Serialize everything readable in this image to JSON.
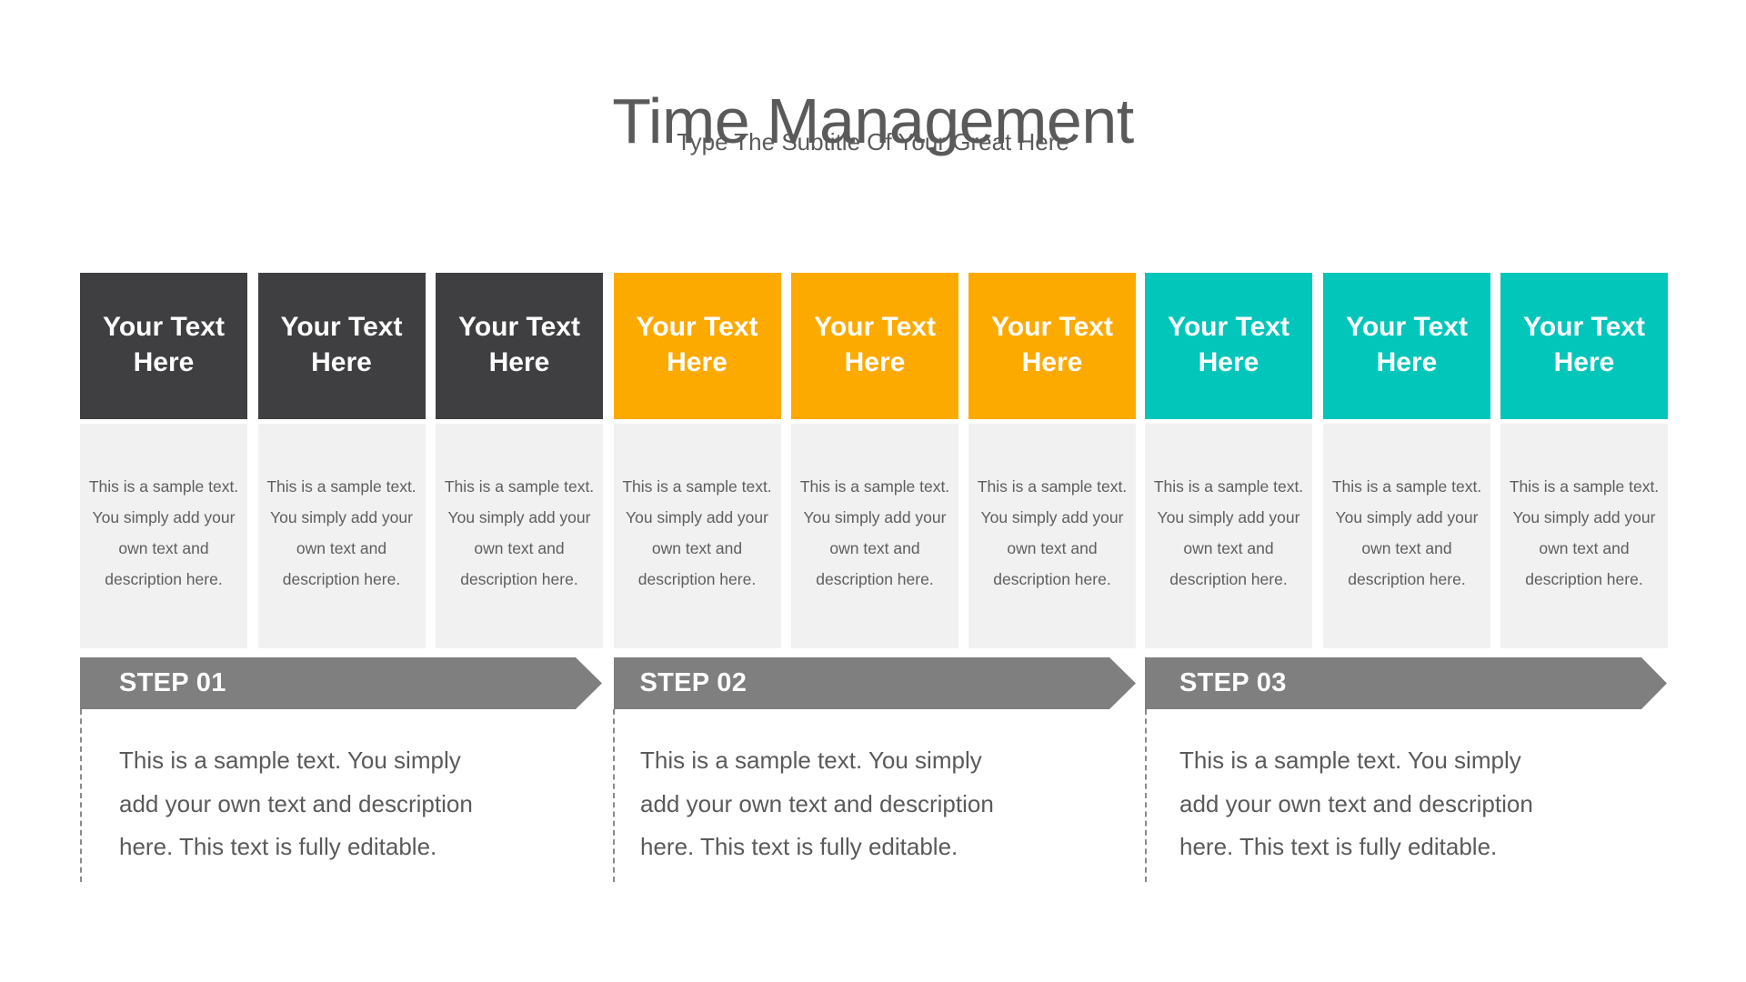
{
  "header": {
    "title": "Time Management",
    "subtitle": "Type The Subtitle Of Your Great Here"
  },
  "colors": {
    "dark": "#3f3f41",
    "orange": "#fdaa00",
    "teal": "#03c6ba",
    "card_bg": "#f1f1f1",
    "step_bar": "#7f7f7f"
  },
  "columns": [
    {
      "heading": "Your Text Here",
      "body": "This is a sample text. You simply add your own text and description here.",
      "color": "dark"
    },
    {
      "heading": "Your Text Here",
      "body": "This is a sample text. You simply add your own text and description here.",
      "color": "dark"
    },
    {
      "heading": "Your Text Here",
      "body": "This is a sample text. You simply add your own text and description here.",
      "color": "dark"
    },
    {
      "heading": "Your Text Here",
      "body": "This is a sample text. You simply add your own text and description here.",
      "color": "orange"
    },
    {
      "heading": "Your Text Here",
      "body": "This is a sample text. You simply add your own text and description here.",
      "color": "orange"
    },
    {
      "heading": "Your Text Here",
      "body": "This is a sample text. You simply add your own text and description here.",
      "color": "orange"
    },
    {
      "heading": "Your Text Here",
      "body": "This is a sample text. You simply add your own text and description here.",
      "color": "teal"
    },
    {
      "heading": "Your Text Here",
      "body": "This is a sample text. You simply add your own text and description here.",
      "color": "teal"
    },
    {
      "heading": "Your Text Here",
      "body": "This is a sample text. You simply add your own text and description here.",
      "color": "teal"
    }
  ],
  "steps": [
    {
      "label": "STEP 01",
      "text": "This is a sample text. You simply add your own text and description here. This text is fully editable."
    },
    {
      "label": "STEP 02",
      "text": "This is a sample text. You simply add your own text and description here. This text is fully editable."
    },
    {
      "label": "STEP 03",
      "text": "This is a sample text. You simply add your own text and description here. This text is fully editable."
    }
  ]
}
